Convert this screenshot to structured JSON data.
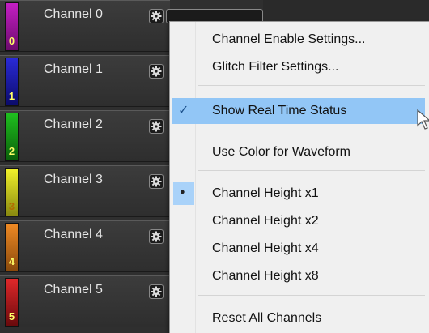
{
  "channels": [
    {
      "label": "Channel 0",
      "number": "0",
      "color": "#c41fc4",
      "dark": "#6d0b6d",
      "numColor": "#ffff66"
    },
    {
      "label": "Channel 1",
      "number": "1",
      "color": "#2a2ad6",
      "dark": "#0b0b6a",
      "numColor": "#ffff66"
    },
    {
      "label": "Channel 2",
      "number": "2",
      "color": "#1fbf1f",
      "dark": "#0a5f0a",
      "numColor": "#ffff66"
    },
    {
      "label": "Channel 3",
      "number": "3",
      "color": "#f2f22b",
      "dark": "#8a8a10",
      "numColor": "#b36b00"
    },
    {
      "label": "Channel 4",
      "number": "4",
      "color": "#f08a24",
      "dark": "#8a4a0c",
      "numColor": "#ffff66"
    },
    {
      "label": "Channel 5",
      "number": "5",
      "color": "#e0282a",
      "dark": "#6a0a0c",
      "numColor": "#ffff66"
    }
  ],
  "menu": {
    "items": [
      {
        "label": "Channel Enable Settings...",
        "checked": false,
        "radio": false,
        "selected": false
      },
      {
        "label": "Glitch Filter Settings...",
        "checked": false,
        "radio": false,
        "selected": false
      },
      {
        "label": "Show Real Time Status",
        "checked": true,
        "radio": false,
        "selected": true
      },
      {
        "label": "Use Color for Waveform",
        "checked": false,
        "radio": false,
        "selected": false
      },
      {
        "label": "Channel Height x1",
        "checked": false,
        "radio": true,
        "selected": false
      },
      {
        "label": "Channel Height x2",
        "checked": false,
        "radio": false,
        "selected": false
      },
      {
        "label": "Channel Height x4",
        "checked": false,
        "radio": false,
        "selected": false
      },
      {
        "label": "Channel Height x8",
        "checked": false,
        "radio": false,
        "selected": false
      },
      {
        "label": "Reset All Channels",
        "checked": false,
        "radio": false,
        "selected": false
      }
    ],
    "checkmark": "✓",
    "radio_mark": "●"
  }
}
